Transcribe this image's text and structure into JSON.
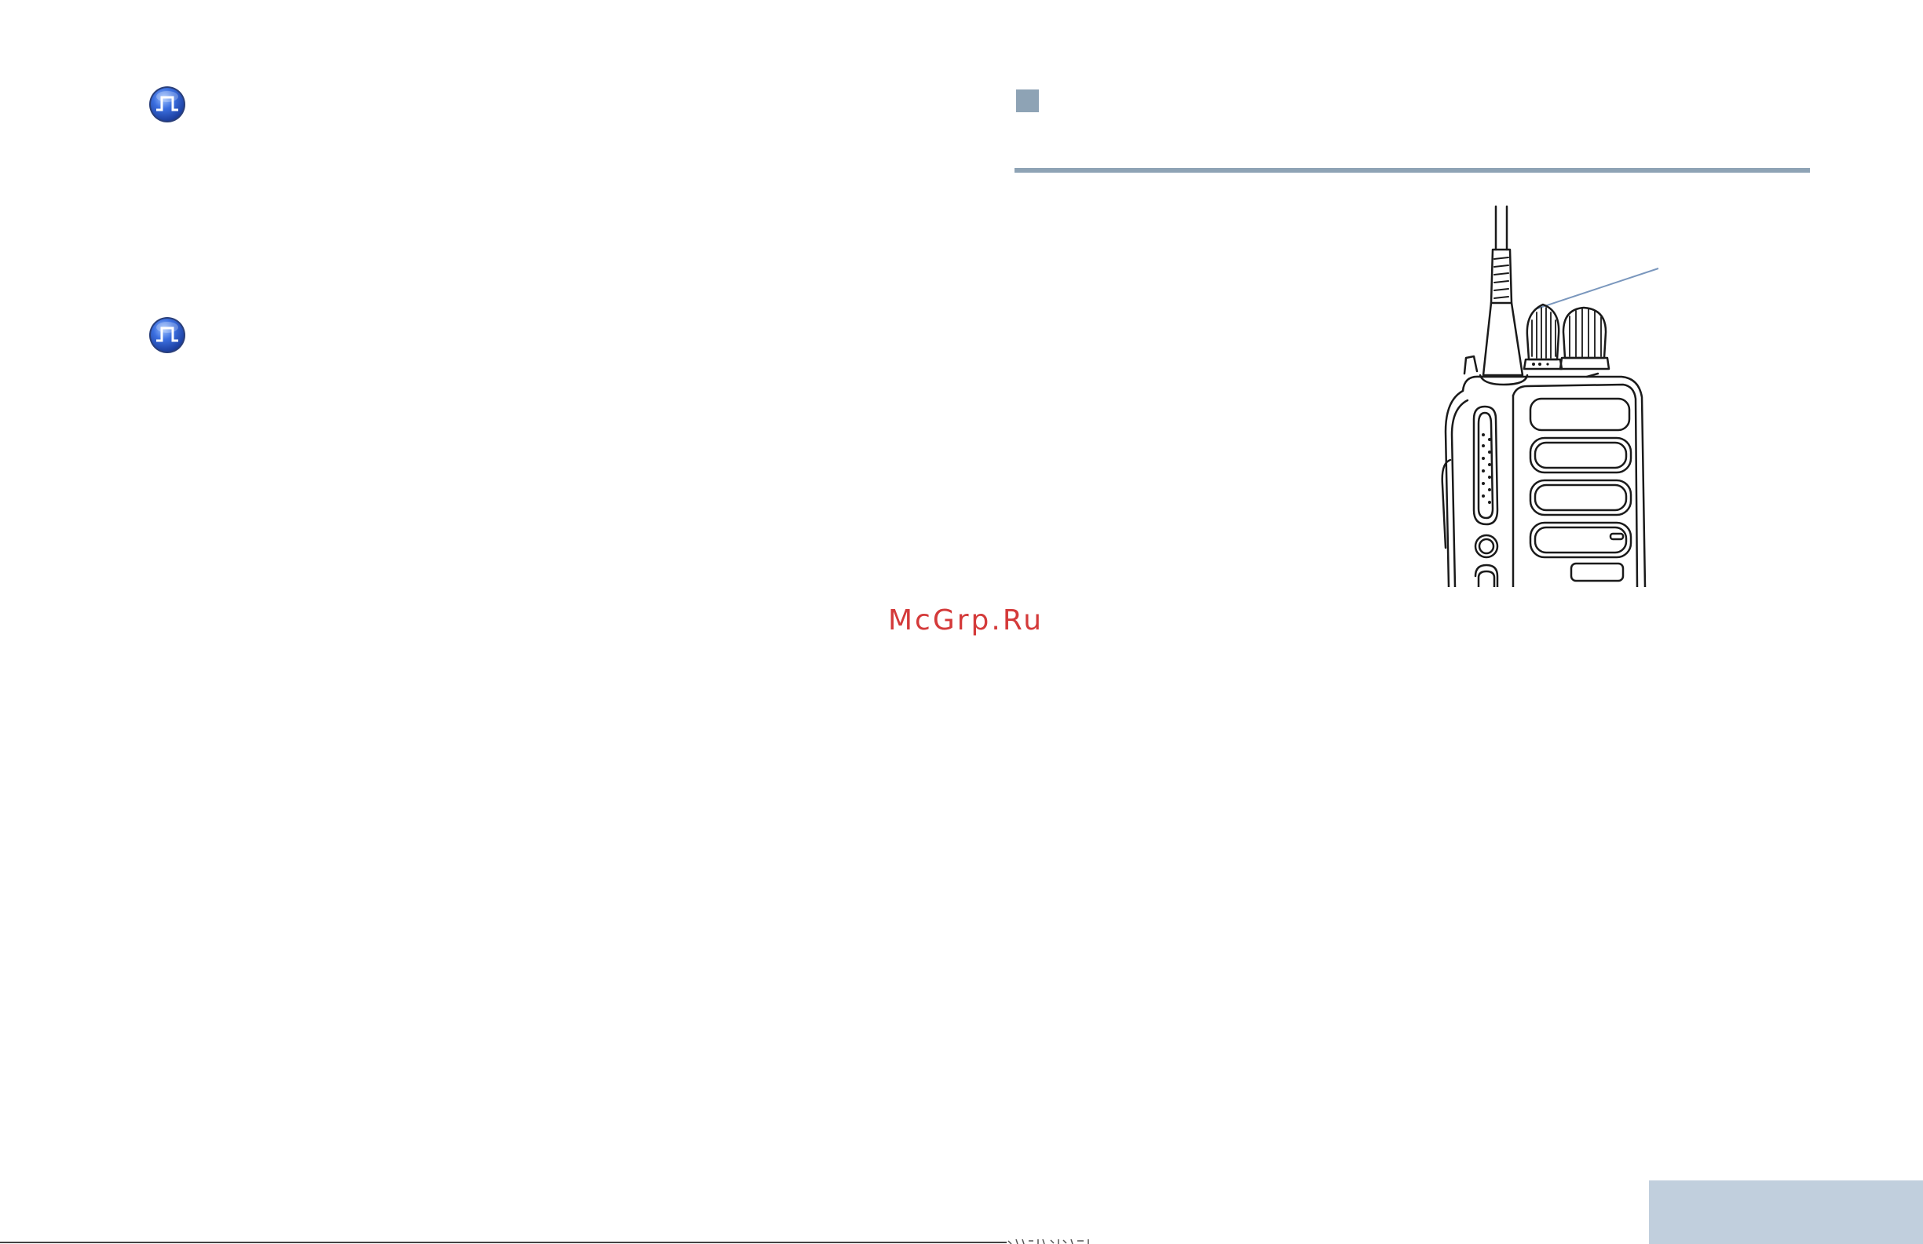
{
  "watermark": {
    "text": "McGrp.Ru",
    "color": "#d43a3a"
  },
  "icons": {
    "first": "digital-mode-icon",
    "second": "digital-mode-icon"
  },
  "figure": {
    "subject": "radio-illustration"
  },
  "colors": {
    "accent": "#8ea3b5",
    "icon_blue": "#2f5fd6",
    "page_tab": "#c1cfdd"
  }
}
